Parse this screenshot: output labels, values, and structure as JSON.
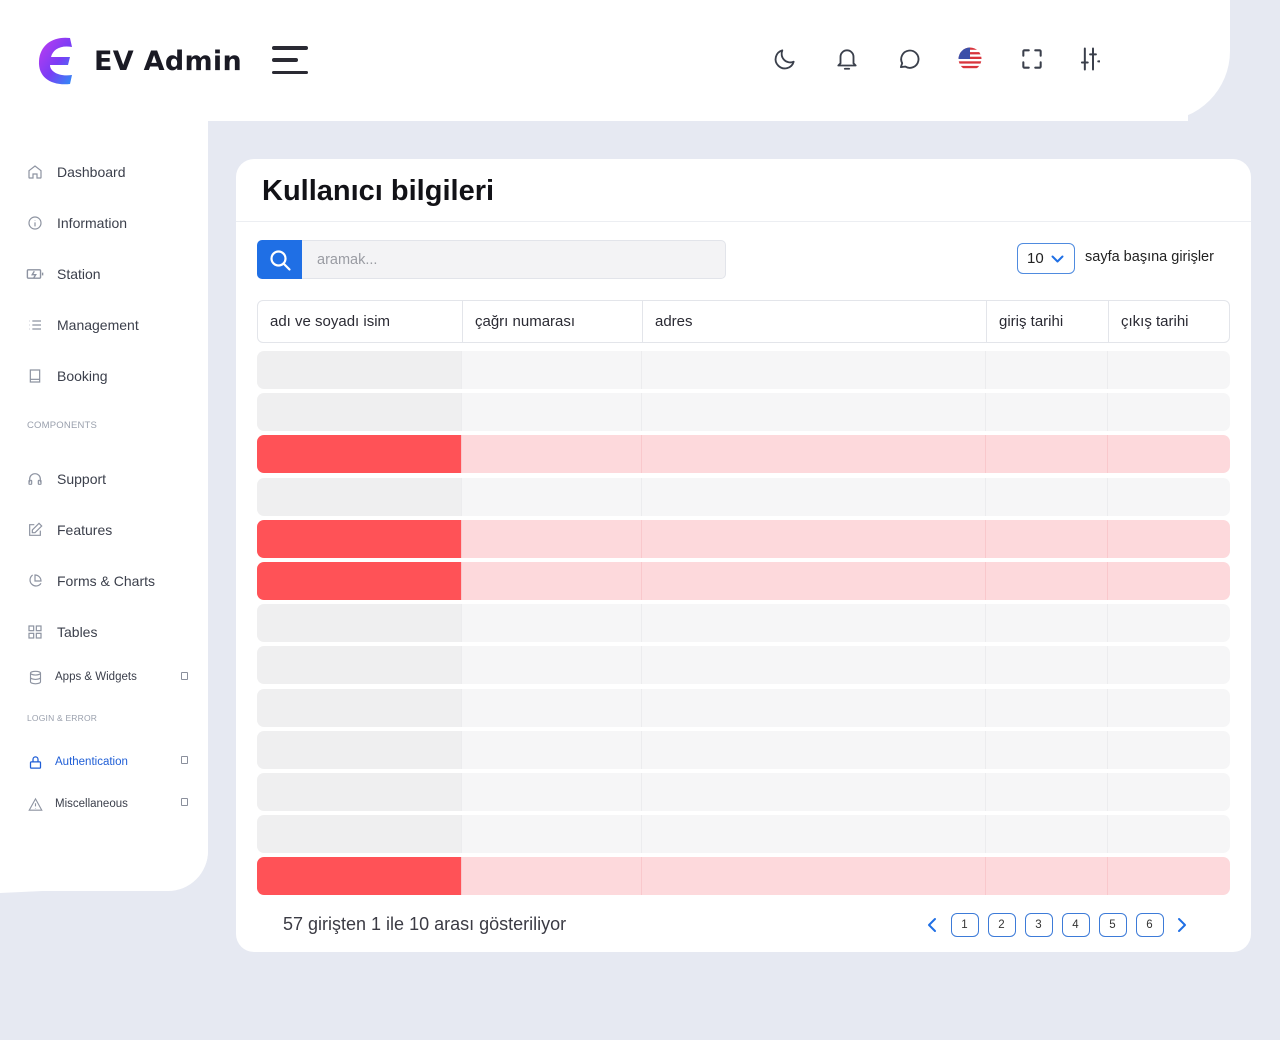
{
  "header": {
    "brand": "EV Admin",
    "icons": [
      "moon-icon",
      "bell-icon",
      "chat-icon",
      "us-flag-icon",
      "fullscreen-icon",
      "sliders-icon"
    ]
  },
  "sidebar": {
    "items": [
      {
        "label": "Dashboard",
        "icon": "home-icon"
      },
      {
        "label": "Information",
        "icon": "info-icon"
      },
      {
        "label": "Station",
        "icon": "battery-charging-icon"
      },
      {
        "label": "Management",
        "icon": "list-icon"
      },
      {
        "label": "Booking",
        "icon": "book-icon"
      }
    ],
    "section_components": "COMPONENTS",
    "components": [
      {
        "label": "Support",
        "icon": "headphones-icon"
      },
      {
        "label": "Features",
        "icon": "edit-icon"
      },
      {
        "label": "Forms & Charts",
        "icon": "pie-chart-icon"
      },
      {
        "label": "Tables",
        "icon": "grid-icon"
      },
      {
        "label": "Apps & Widgets",
        "icon": "database-icon"
      }
    ],
    "section_login": "LOGIN & ERROR",
    "login": [
      {
        "label": "Authentication",
        "icon": "lock-icon"
      },
      {
        "label": "Miscellaneous",
        "icon": "warning-icon"
      }
    ]
  },
  "main": {
    "title": "Kullanıcı bilgileri",
    "search_placeholder": "aramak...",
    "per_page_value": "10",
    "per_page_label": "sayfa başına girişler",
    "columns": [
      "adı ve soyadı isim",
      "çağrı numarası",
      "adres",
      "giriş tarihi",
      "çıkış tarihi"
    ],
    "row_states": [
      "normal",
      "normal",
      "alert",
      "normal",
      "alert",
      "alert",
      "normal",
      "normal",
      "normal",
      "normal",
      "normal",
      "normal",
      "alert"
    ],
    "info_text": "57 girişten 1 ile 10 arası gösteriliyor",
    "pages": [
      "1",
      "2",
      "3",
      "4",
      "5",
      "6"
    ]
  },
  "colors": {
    "primary": "#1f6fe5",
    "alert_strong": "#ff5257",
    "alert_light": "#fdd9dc",
    "background": "#e6e9f2"
  }
}
